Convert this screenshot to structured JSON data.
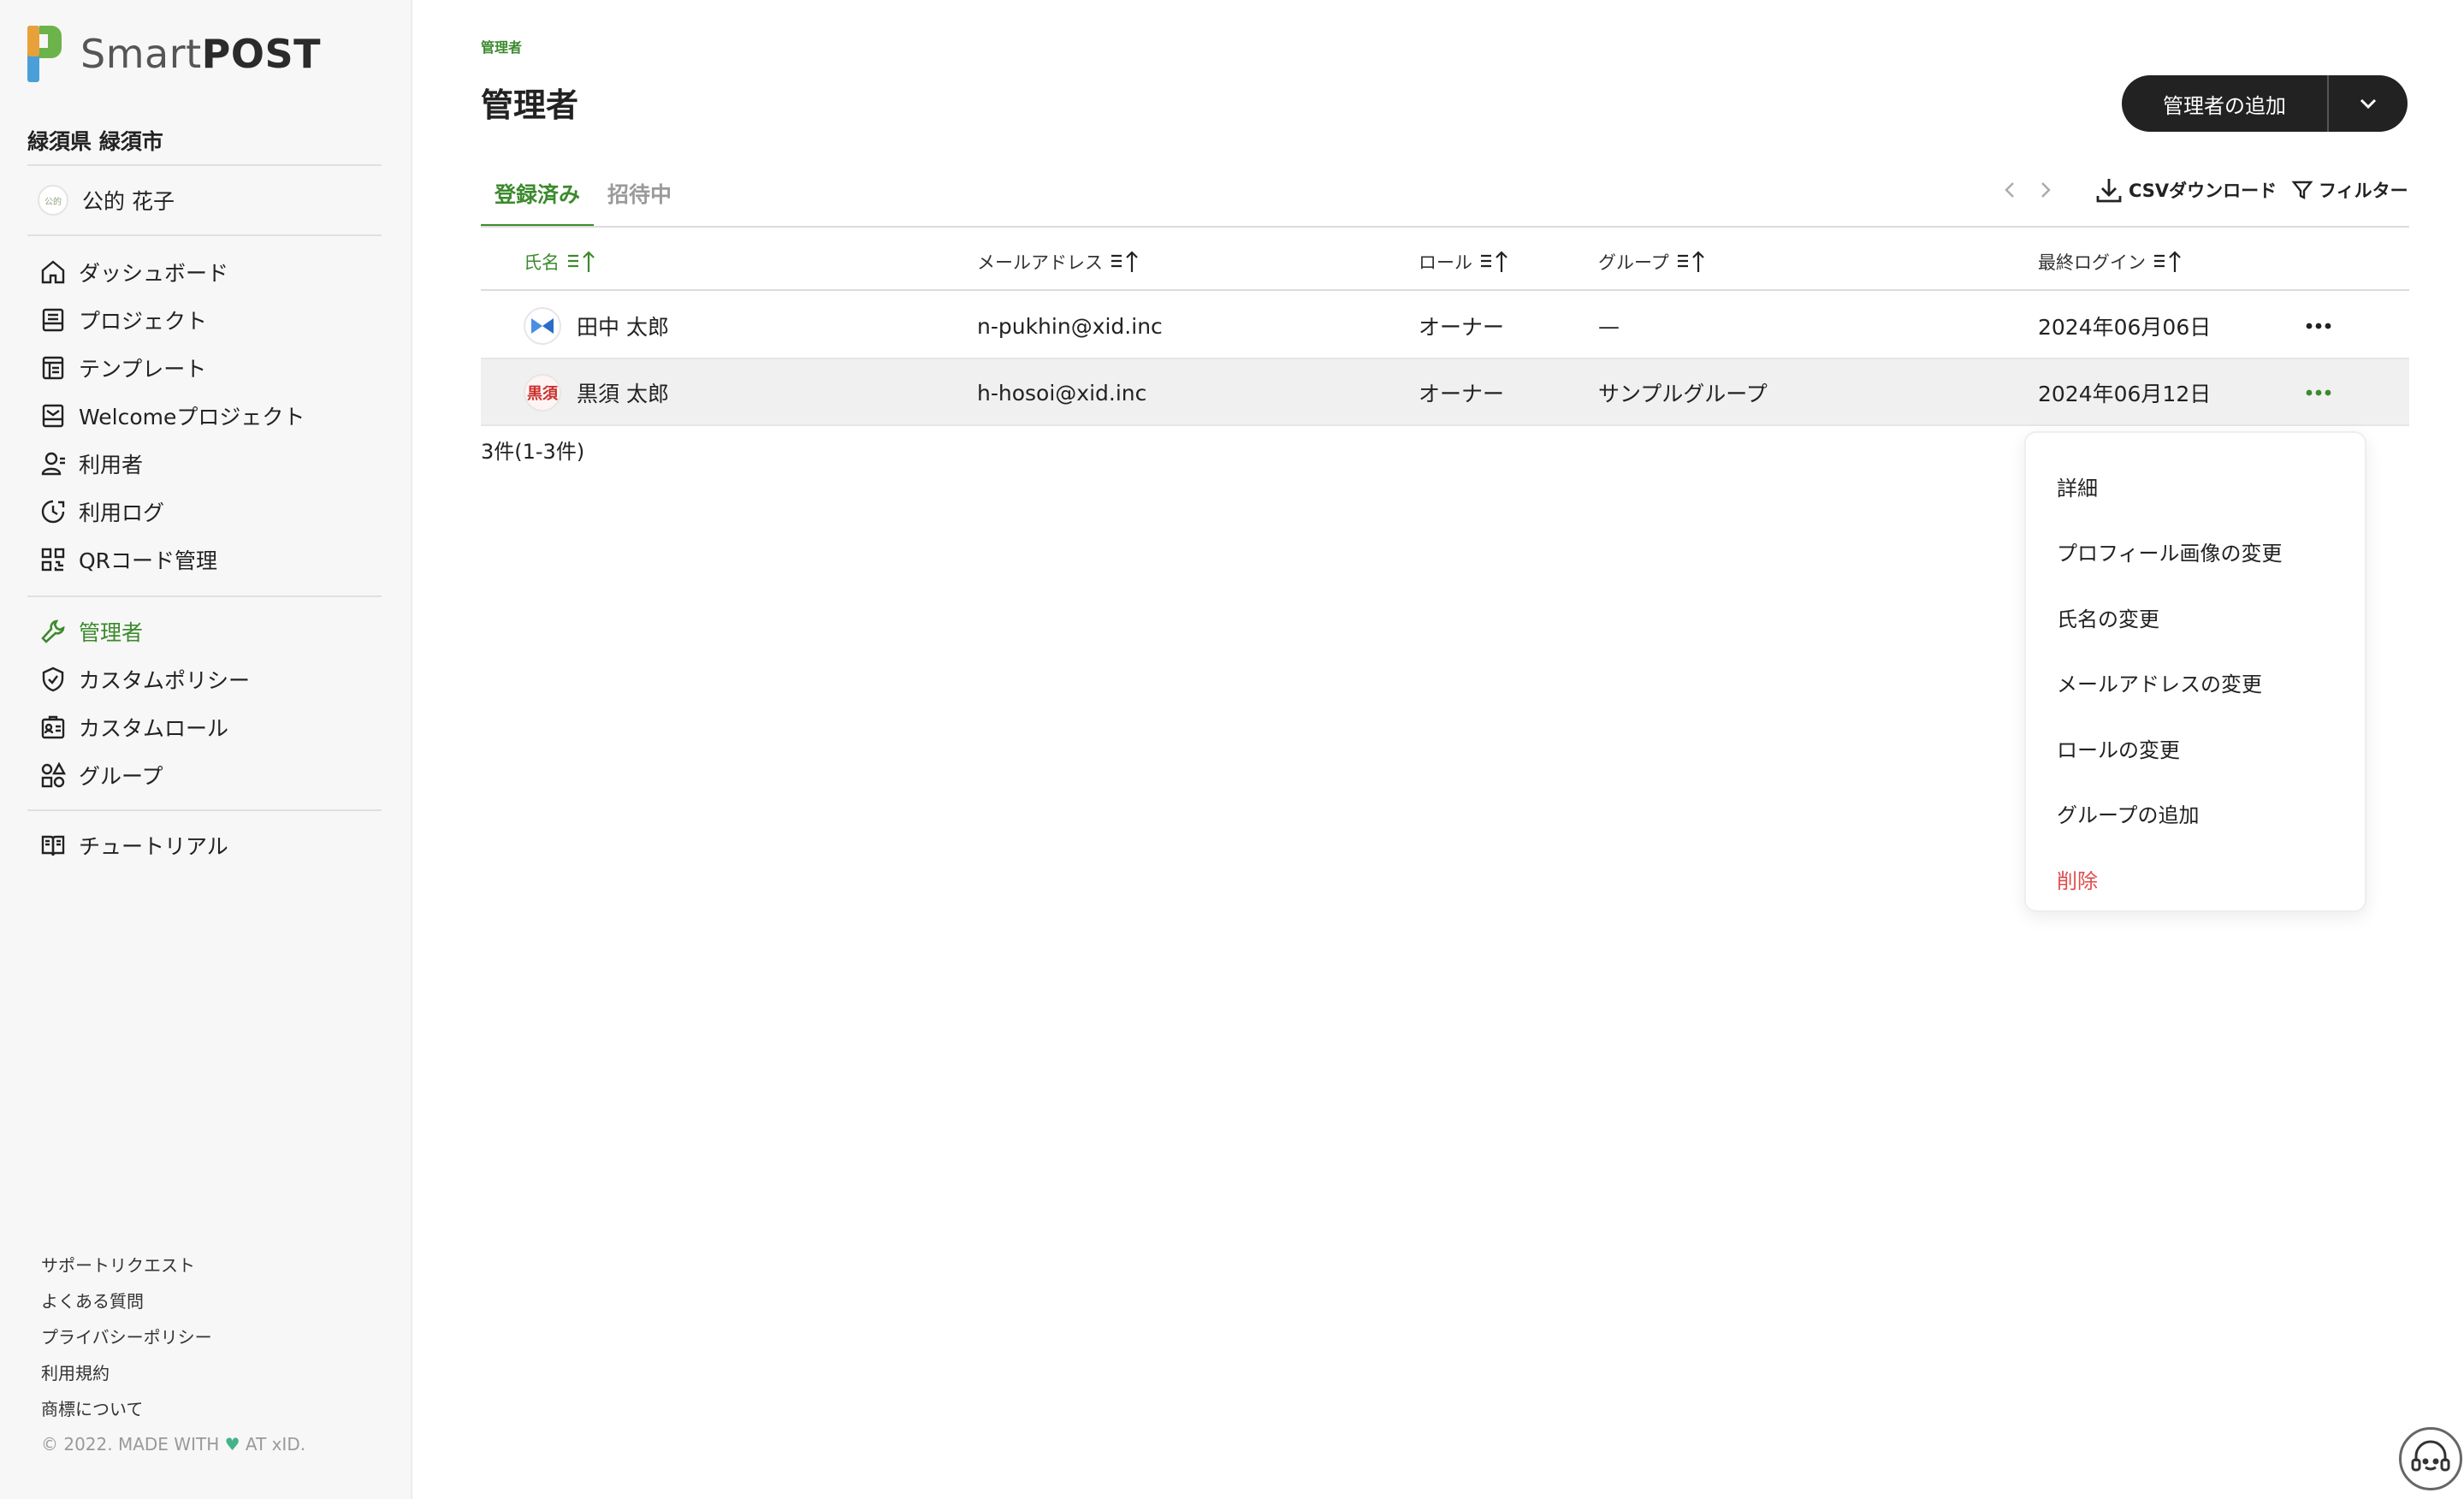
{
  "app": {
    "logo_light": "Smart",
    "logo_bold": "POST"
  },
  "sidebar": {
    "org": "緑須県 緑須市",
    "user": {
      "avatar_text": "公的",
      "name": "公的 花子"
    },
    "group1": [
      {
        "icon": "home-icon",
        "label": "ダッシュボード"
      },
      {
        "icon": "project-icon",
        "label": "プロジェクト"
      },
      {
        "icon": "template-icon",
        "label": "テンプレート"
      },
      {
        "icon": "welcome-icon",
        "label": "Welcomeプロジェクト"
      },
      {
        "icon": "user-icon",
        "label": "利用者"
      },
      {
        "icon": "log-icon",
        "label": "利用ログ"
      },
      {
        "icon": "qr-icon",
        "label": "QRコード管理"
      }
    ],
    "group2": [
      {
        "icon": "wrench-icon",
        "label": "管理者",
        "active": true
      },
      {
        "icon": "shield-icon",
        "label": "カスタムポリシー"
      },
      {
        "icon": "id-card-icon",
        "label": "カスタムロール"
      },
      {
        "icon": "group-icon",
        "label": "グループ"
      }
    ],
    "group3": [
      {
        "icon": "book-icon",
        "label": "チュートリアル"
      }
    ],
    "footer_links": [
      "サポートリクエスト",
      "よくある質問",
      "プライバシーポリシー",
      "利用規約",
      "商標について"
    ],
    "copyright_prefix": "© 2022. MADE WITH",
    "copyright_suffix": "AT xID."
  },
  "main": {
    "breadcrumb": "管理者",
    "title": "管理者",
    "add_button": "管理者の追加",
    "tabs": [
      {
        "label": "登録済み",
        "active": true
      },
      {
        "label": "招待中",
        "active": false
      }
    ],
    "csv_download": "CSVダウンロード",
    "filter": "フィルター",
    "columns": [
      "氏名",
      "メールアドレス",
      "ロール",
      "グループ",
      "最終ログイン"
    ],
    "rows": [
      {
        "avatar": "logo",
        "name": "田中 太郎",
        "email": "n-pukhin@xid.inc",
        "role": "オーナー",
        "group": "—",
        "last_login": "2024年06月06日"
      },
      {
        "avatar": "黒須",
        "name": "黒須 太郎",
        "email": "h-hosoi@xid.inc",
        "role": "オーナー",
        "group": "サンプルグループ",
        "last_login": "2024年06月12日"
      }
    ],
    "count": "3件(1-3件)",
    "context_menu": [
      "詳細",
      "プロフィール画像の変更",
      "氏名の変更",
      "メールアドレスの変更",
      "ロールの変更",
      "グループの追加",
      "削除"
    ]
  },
  "colors": {
    "accent": "#3c8a2e",
    "danger": "#e24b4b",
    "button_dark": "#222222"
  }
}
